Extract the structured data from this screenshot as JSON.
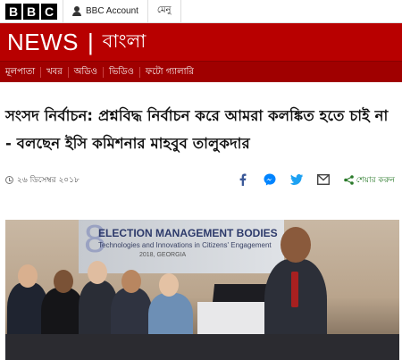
{
  "topbar": {
    "logo_letters": [
      "B",
      "B",
      "C"
    ],
    "account_label": "BBC Account",
    "menu_label": "মেনু"
  },
  "brand": {
    "news": "NEWS",
    "separator": "|",
    "language": "বাংলা"
  },
  "nav": {
    "items": [
      "মূলপাতা",
      "খবর",
      "অডিও",
      "ভিডিও",
      "ফটো গ্যালারি"
    ]
  },
  "article": {
    "headline": "সংসদ নির্বাচন: প্রশ্নবিদ্ধ নির্বাচন করে আমরা কলঙ্কিত হতে চাই না - বলছেন ইসি কমিশনার মাহবুব তালুকদার",
    "date": "২৬ ডিসেম্বর ২০১৮",
    "share_label": "শেয়ার করুন"
  },
  "photo": {
    "banner_number": "8",
    "banner_title": "ELECTION MANAGEMENT BODIES",
    "banner_subtitle": "Technologies and Innovations in Citizens' Engagement",
    "banner_location": "2018, GEORGIA"
  },
  "colors": {
    "brand_red": "#b80000",
    "nav_red": "#a00000",
    "facebook": "#3b5998",
    "messenger": "#0084ff",
    "twitter": "#1da1f2",
    "share_green": "#2a7a2a"
  },
  "icons": {
    "account": "person-icon",
    "date": "clock-icon",
    "share": [
      "facebook-icon",
      "messenger-icon",
      "twitter-icon",
      "email-icon",
      "share-icon"
    ]
  }
}
